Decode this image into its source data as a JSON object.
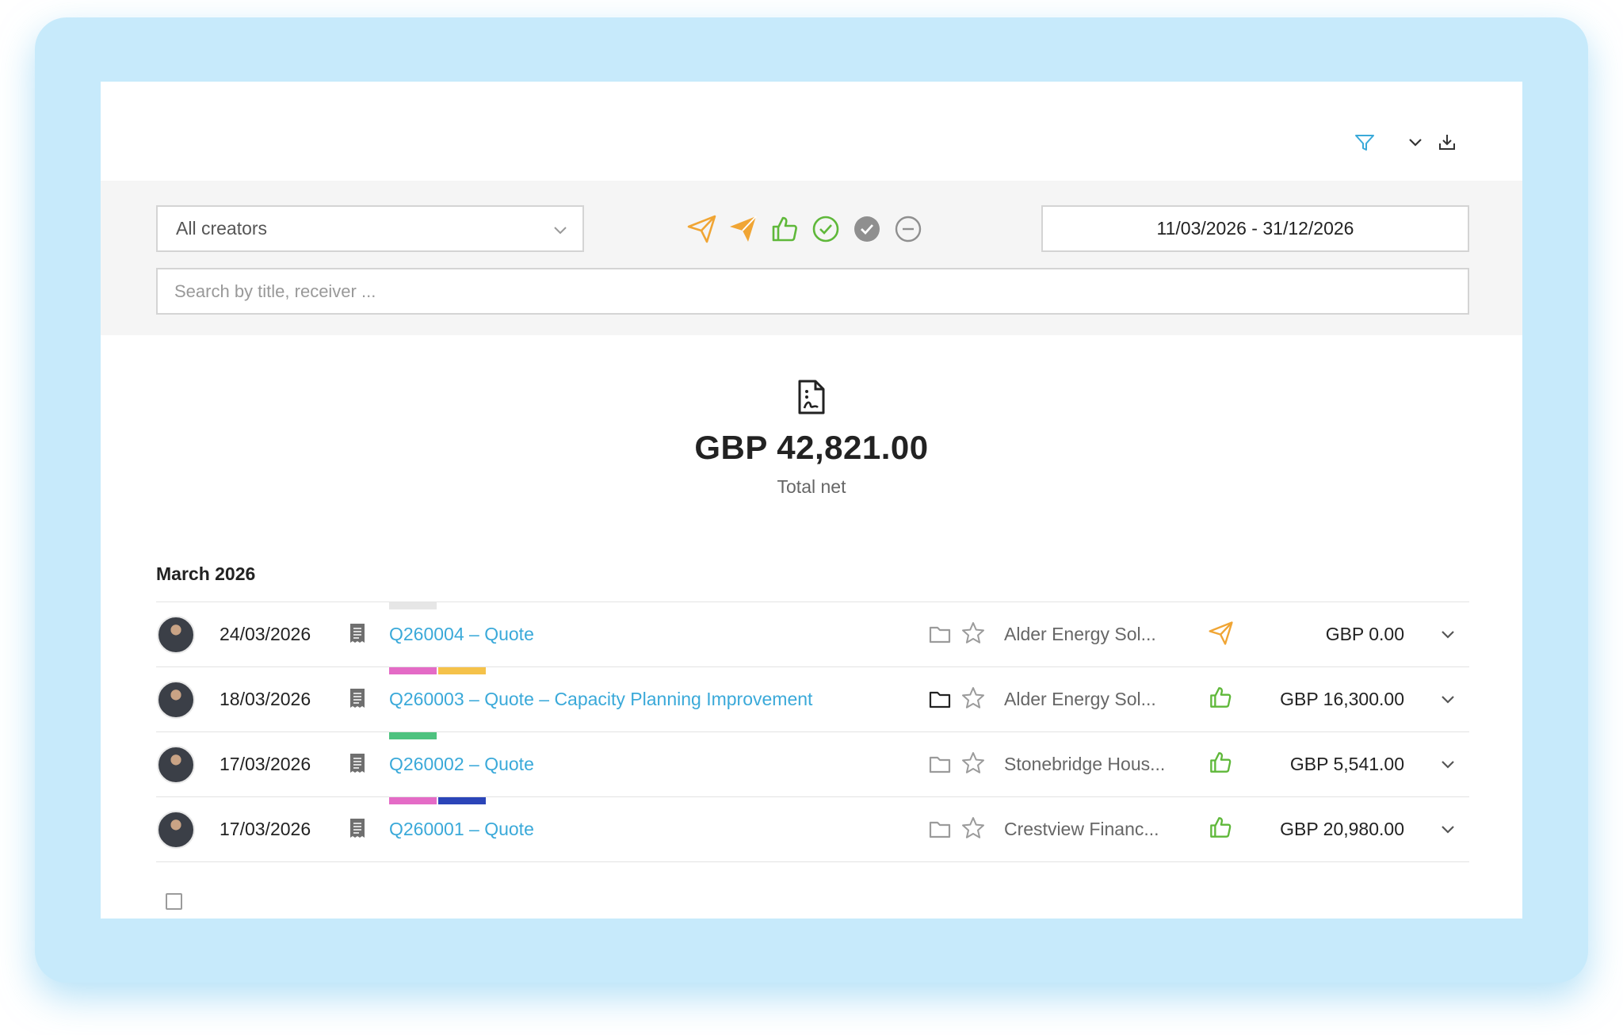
{
  "filters": {
    "creator_select": "All creators",
    "date_range": "11/03/2026 - 31/12/2026",
    "search_placeholder": "Search by title, receiver ...",
    "status_icons": [
      "paper-plane-outline-icon",
      "paper-plane-filled-icon",
      "thumbs-up-icon",
      "check-circle-icon",
      "check-circle-filled-icon",
      "minus-circle-icon"
    ]
  },
  "summary": {
    "amount": "GBP 42,821.00",
    "label": "Total net"
  },
  "month": "March 2026",
  "rows": [
    {
      "date": "24/03/2026",
      "title": "Q260004 – Quote",
      "receiver": "Alder Energy Sol...",
      "amount": "GBP 0.00",
      "status": "sent",
      "tags": [
        "#e6e6e6"
      ]
    },
    {
      "date": "18/03/2026",
      "title": "Q260003 – Quote – Capacity Planning Improvement",
      "receiver": "Alder Energy Sol...",
      "amount": "GBP 16,300.00",
      "status": "accepted",
      "tags": [
        "#e46bc6",
        "#f5c24a"
      ]
    },
    {
      "date": "17/03/2026",
      "title": "Q260002 – Quote",
      "receiver": "Stonebridge Hous...",
      "amount": "GBP 5,541.00",
      "status": "accepted",
      "tags": [
        "#4ec27f"
      ]
    },
    {
      "date": "17/03/2026",
      "title": "Q260001 – Quote",
      "receiver": "Crestview Financ...",
      "amount": "GBP 20,980.00",
      "status": "accepted",
      "tags": [
        "#e46bc6",
        "#2b45b8"
      ]
    }
  ],
  "colors": {
    "link": "#3aa9d9",
    "sent": "#f0a534",
    "accepted": "#5fb83a",
    "frame": "#c7eafb"
  }
}
